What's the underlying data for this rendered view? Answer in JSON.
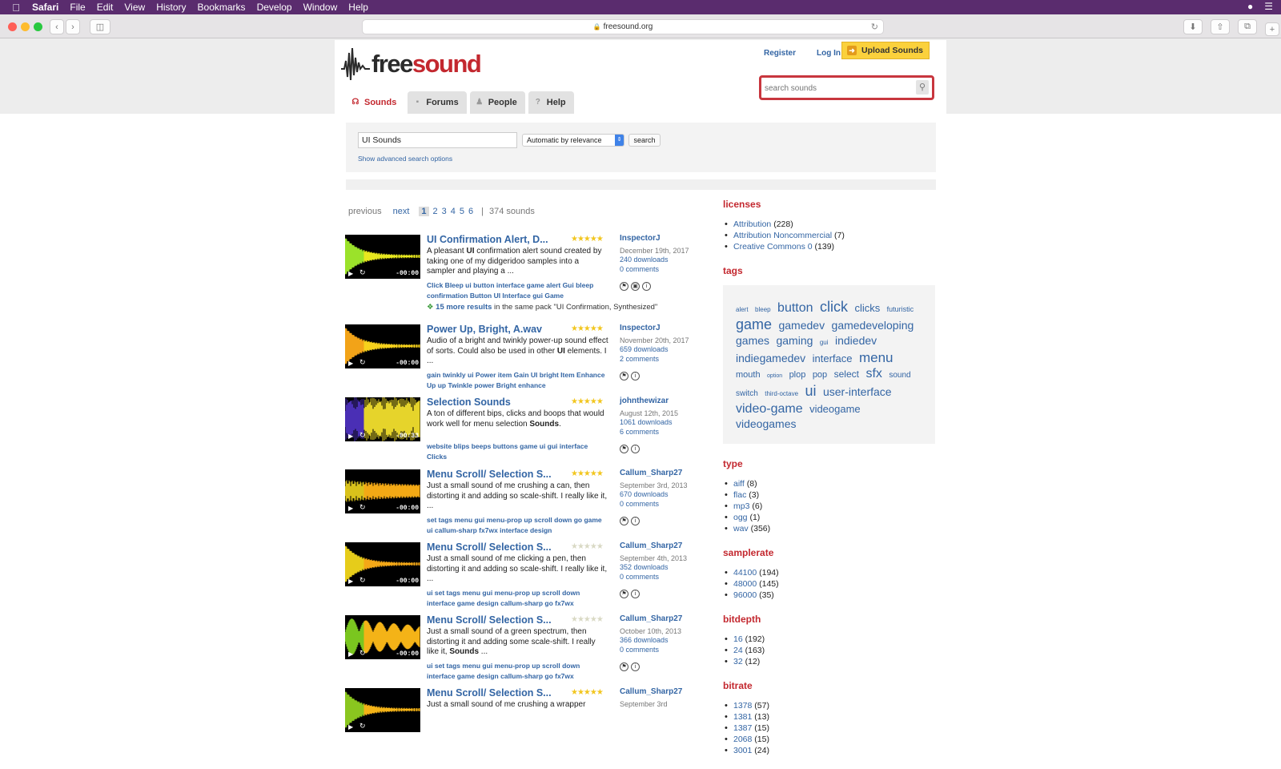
{
  "os_menubar": {
    "apple": "",
    "items": [
      "Safari",
      "File",
      "Edit",
      "View",
      "History",
      "Bookmarks",
      "Develop",
      "Window",
      "Help"
    ]
  },
  "browser": {
    "url": "freesound.org"
  },
  "header": {
    "logo_text_1": "free",
    "logo_text_2": "sound",
    "register": "Register",
    "login": "Log In",
    "upload": "Upload Sounds",
    "search_placeholder": "search sounds"
  },
  "nav": {
    "tabs": [
      "Sounds",
      "Forums",
      "People",
      "Help"
    ]
  },
  "search_form": {
    "query": "UI Sounds",
    "sort": "Automatic by relevance",
    "button": "search",
    "advanced": "Show advanced search options"
  },
  "pager": {
    "previous": "previous",
    "next": "next",
    "pages": [
      "1",
      "2",
      "3",
      "4",
      "5",
      "6"
    ],
    "count": "374 sounds"
  },
  "results": [
    {
      "title": "UI Confirmation Alert, D...",
      "duration": "-00:00",
      "rating": 5,
      "desc_html_1": "A pleasant ",
      "desc_bold": "UI",
      "desc_html_2": " confirmation alert sound created by taking one of my didgeridoo samples into a sampler and playing a ...",
      "tags": "Click Bleep ui button interface game alert Gui bleep confirmation Button UI Interface gui Game",
      "user": "InspectorJ",
      "date": "December 19th, 2017",
      "downloads": "240 downloads",
      "comments": "0 comments",
      "more_link": "15 more results",
      "more_text": " in the same pack \"UI Confirmation, Synthesized\""
    },
    {
      "title": "Power Up, Bright, A.wav",
      "duration": "-00:00",
      "rating": 5,
      "desc_html_1": "Audio of a bright and twinkly power-up sound effect of sorts. Could also be used in other ",
      "desc_bold": "UI",
      "desc_html_2": " elements. I ...",
      "tags": "gain twinkly ui Power item Gain UI bright Item Enhance Up up Twinkle power Bright enhance",
      "user": "InspectorJ",
      "date": "November 20th, 2017",
      "downloads": "659 downloads",
      "comments": "2 comments"
    },
    {
      "title": "Selection Sounds",
      "duration": "-00:33",
      "rating": 5,
      "desc_html_1": "A ton of different bips, clicks and boops that would work well for menu selection ",
      "desc_bold": "Sounds",
      "desc_html_2": ".",
      "tags": "website blips beeps buttons game ui gui interface Clicks",
      "user": "johnthewizar",
      "date": "August 12th, 2015",
      "downloads": "1061 downloads",
      "comments": "6 comments"
    },
    {
      "title": "Menu Scroll/ Selection S...",
      "duration": "-00:00",
      "rating": 5,
      "desc_html_1": "Just a small sound of me crushing a can, then distorting it and adding so scale-shift. I really like it, ...",
      "desc_bold": "",
      "desc_html_2": "",
      "tags": "set tags menu gui menu-prop up scroll down go game ui callum-sharp fx7wx interface design",
      "user": "Callum_Sharp27",
      "date": "September 3rd, 2013",
      "downloads": "670 downloads",
      "comments": "0 comments"
    },
    {
      "title": "Menu Scroll/ Selection S...",
      "duration": "-00:00",
      "rating": 0,
      "desc_html_1": "Just a small sound of me clicking a pen, then distorting it and adding so scale-shift. I really like it, ...",
      "desc_bold": "",
      "desc_html_2": "",
      "tags": "ui set tags menu gui menu-prop up scroll down interface game design callum-sharp go fx7wx",
      "user": "Callum_Sharp27",
      "date": "September 4th, 2013",
      "downloads": "352 downloads",
      "comments": "0 comments"
    },
    {
      "title": "Menu Scroll/ Selection S...",
      "duration": "-00:00",
      "rating": 0,
      "desc_html_1": "Just a small sound of a green spectrum, then distorting it and adding some scale-shift. I really like it, ",
      "desc_bold": "Sounds",
      "desc_html_2": " ...",
      "tags": "ui set tags menu gui menu-prop up scroll down interface game design callum-sharp go fx7wx",
      "user": "Callum_Sharp27",
      "date": "October 10th, 2013",
      "downloads": "366 downloads",
      "comments": "0 comments"
    },
    {
      "title": "Menu Scroll/ Selection S...",
      "duration": "",
      "rating": 5,
      "desc_html_1": "Just a small sound of me crushing a wrapper",
      "desc_bold": "",
      "desc_html_2": "",
      "tags": "",
      "user": "Callum_Sharp27",
      "date": "September 3rd",
      "downloads": "",
      "comments": ""
    }
  ],
  "sidebar": {
    "licenses_title": "licenses",
    "licenses": [
      {
        "name": "Attribution",
        "count": "(228)"
      },
      {
        "name": "Attribution Noncommercial",
        "count": "(7)"
      },
      {
        "name": "Creative Commons 0",
        "count": "(139)"
      }
    ],
    "tags_title": "tags",
    "tags": [
      {
        "t": "alert",
        "s": 8
      },
      {
        "t": "bleep",
        "s": 8
      },
      {
        "t": "button",
        "s": 16
      },
      {
        "t": "click",
        "s": 18
      },
      {
        "t": "clicks",
        "s": 13
      },
      {
        "t": "futuristic",
        "s": 9
      },
      {
        "t": "game",
        "s": 18
      },
      {
        "t": "gamedev",
        "s": 14
      },
      {
        "t": "gamedeveloping",
        "s": 14
      },
      {
        "t": "games",
        "s": 14
      },
      {
        "t": "gaming",
        "s": 14
      },
      {
        "t": "gui",
        "s": 8
      },
      {
        "t": "indiedev",
        "s": 14
      },
      {
        "t": "indiegamedev",
        "s": 14
      },
      {
        "t": "interface",
        "s": 13
      },
      {
        "t": "menu",
        "s": 17
      },
      {
        "t": "mouth",
        "s": 11
      },
      {
        "t": "option",
        "s": 7
      },
      {
        "t": "plop",
        "s": 11
      },
      {
        "t": "pop",
        "s": 11
      },
      {
        "t": "select",
        "s": 12
      },
      {
        "t": "sfx",
        "s": 16
      },
      {
        "t": "sound",
        "s": 10
      },
      {
        "t": "switch",
        "s": 10
      },
      {
        "t": "third-octave",
        "s": 8
      },
      {
        "t": "ui",
        "s": 18
      },
      {
        "t": "user-interface",
        "s": 14
      },
      {
        "t": "video-game",
        "s": 16
      },
      {
        "t": "videogame",
        "s": 13
      },
      {
        "t": "videogames",
        "s": 14
      }
    ],
    "type_title": "type",
    "types": [
      {
        "name": "aiff",
        "count": "(8)"
      },
      {
        "name": "flac",
        "count": "(3)"
      },
      {
        "name": "mp3",
        "count": "(6)"
      },
      {
        "name": "ogg",
        "count": "(1)"
      },
      {
        "name": "wav",
        "count": "(356)"
      }
    ],
    "samplerate_title": "samplerate",
    "samplerates": [
      {
        "name": "44100",
        "count": "(194)"
      },
      {
        "name": "48000",
        "count": "(145)"
      },
      {
        "name": "96000",
        "count": "(35)"
      }
    ],
    "bitdepth_title": "bitdepth",
    "bitdepths": [
      {
        "name": "16",
        "count": "(192)"
      },
      {
        "name": "24",
        "count": "(163)"
      },
      {
        "name": "32",
        "count": "(12)"
      }
    ],
    "bitrate_title": "bitrate",
    "bitrates": [
      {
        "name": "1378",
        "count": "(57)"
      },
      {
        "name": "1381",
        "count": "(13)"
      },
      {
        "name": "1387",
        "count": "(15)"
      },
      {
        "name": "2068",
        "count": "(15)"
      },
      {
        "name": "3001",
        "count": "(24)"
      }
    ]
  },
  "colors": {
    "brand_red": "#c3282f",
    "link_blue": "#3365a4",
    "upload_yellow": "#fbd13c",
    "menubar_purple": "#5a2c6e"
  }
}
